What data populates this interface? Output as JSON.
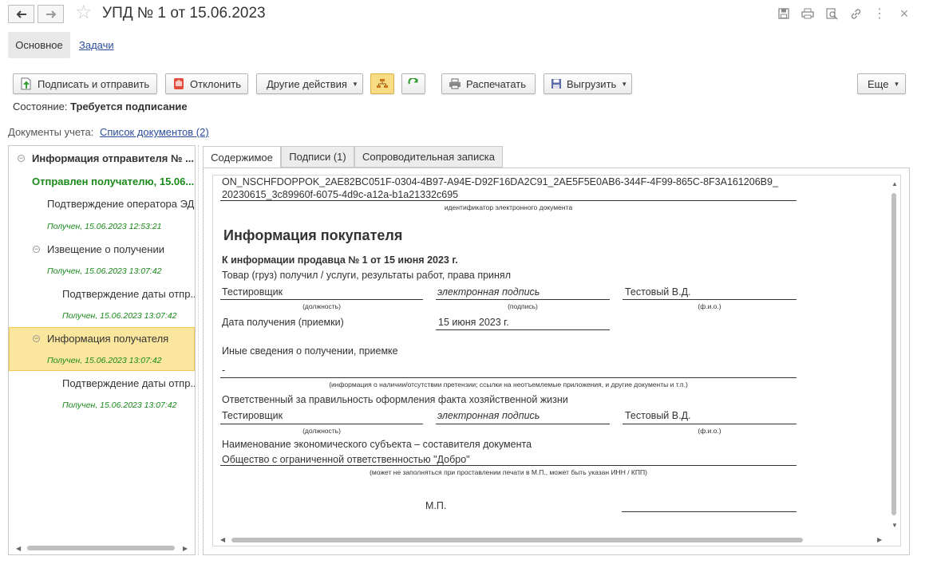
{
  "window": {
    "title": "УПД № 1 от 15.06.2023",
    "close_glyph": "×",
    "more_glyph": "⋮"
  },
  "tabs": {
    "main": "Основное",
    "tasks": "Задачи"
  },
  "toolbar": {
    "sign_send": "Подписать и отправить",
    "reject": "Отклонить",
    "other_actions": "Другие действия",
    "print": "Распечатать",
    "export": "Выгрузить",
    "more": "Еще"
  },
  "status": {
    "label": "Состояние:",
    "value": "Требуется подписание"
  },
  "docs": {
    "label": "Документы учета:",
    "link": "Список документов (2)"
  },
  "tree": {
    "items": [
      {
        "text": "Информация отправителя № ...",
        "bold": true
      },
      {
        "text": "Отправлен получателю, 15.06....",
        "green_bold": true
      },
      {
        "text": "Подтверждение оператора ЭДО"
      },
      {
        "text": "Получен, 15.06.2023 12:53:21"
      },
      {
        "text": "Извещение о получении"
      },
      {
        "text": "Получен, 15.06.2023 13:07:42"
      },
      {
        "text": "Подтверждение даты отпр..."
      },
      {
        "text": "Получен, 15.06.2023 13:07:42"
      },
      {
        "text": "Информация получателя"
      },
      {
        "text": "Получен, 15.06.2023 13:07:42"
      },
      {
        "text": "Подтверждение даты отпр..."
      },
      {
        "text": "Получен, 15.06.2023 13:07:42"
      }
    ]
  },
  "right_tabs": {
    "content": "Содержимое",
    "signatures": "Подписи (1)",
    "cover_note": "Сопроводительная записка"
  },
  "document": {
    "id_line1": "ON_NSCHFDOPPOK_2AE82BC051F-0304-4B97-A94E-D92F16DA2C91_2AE5F5E0AB6-344F-4F99-865C-8F3A161206B9_",
    "id_line2": "20230615_3c89960f-6075-4d9c-a12a-b1a21332c695",
    "id_caption": "идентификатор электронного документа",
    "heading": "Информация покупателя",
    "subheading": "К информации продавца № 1 от 15 июня 2023 г.",
    "received_text": "Товар (груз) получил / услуги, результаты работ, права принял",
    "position_value": "Тестировщик",
    "signature_value": "электронная подпись",
    "name_value": "Тестовый В.Д.",
    "cap_position": "(должность)",
    "cap_signature": "(подпись)",
    "cap_name": "(ф.и.о.)",
    "date_label": "Дата получения (приемки)",
    "date_value": "15 июня 2023 г.",
    "other_info_label": "Иные сведения о получении, приемке",
    "other_info_value": "-",
    "other_info_caption": "(информация о наличии/отсутствии претензии; ссылки на неотъемлемые приложения, и другие  документы и т.п.)",
    "responsible_label": "Ответственный за правильность оформления факта хозяйственной жизни",
    "position_value2": "Тестировщик",
    "signature_value2": "электронная подпись",
    "name_value2": "Тестовый В.Д.",
    "entity_label": "Наименование экономического субъекта – составителя документа",
    "entity_value": "Общество с ограниченной ответственностью \"Добро\"",
    "entity_caption": "(может не заполняться при проставлении печати в М.П., может быть указан ИНН / КПП)",
    "stamp": "М.П."
  },
  "colors": {
    "selected_row": "#fbe69d",
    "green_text": "#1a8a1a",
    "link": "#2b4e9c"
  }
}
